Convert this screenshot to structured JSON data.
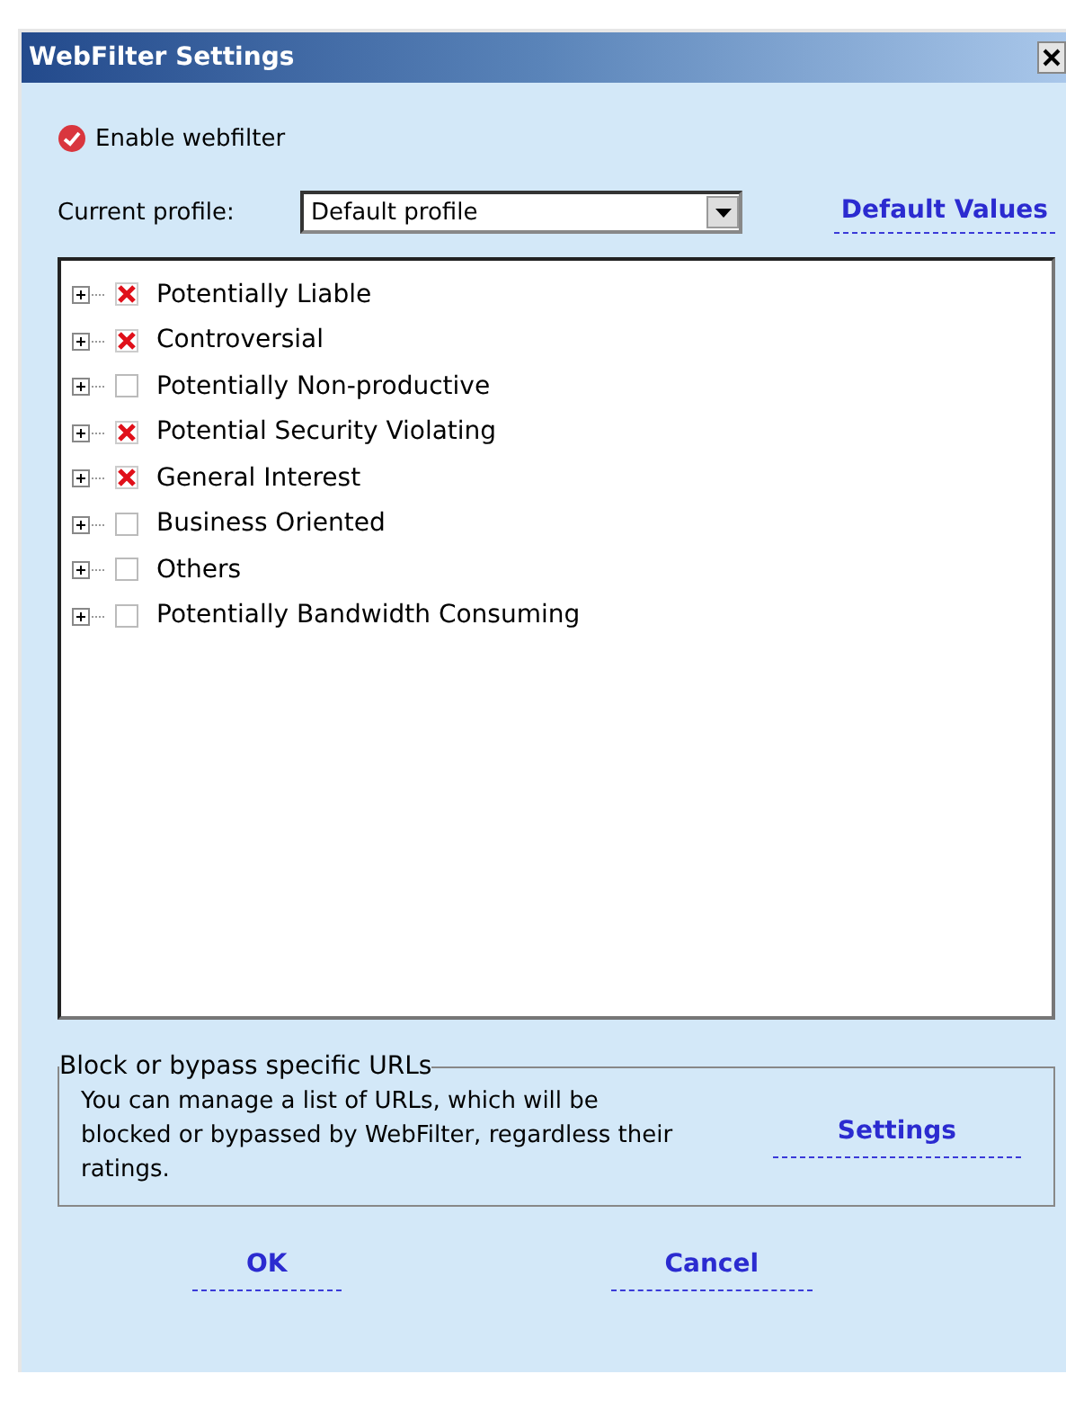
{
  "window": {
    "title": "WebFilter Settings"
  },
  "enable": {
    "label": "Enable webfilter",
    "checked": true
  },
  "profile": {
    "label": "Current profile:",
    "value": "Default profile",
    "default_link": "Default Values"
  },
  "categories": [
    {
      "label": "Potentially Liable",
      "checked": true
    },
    {
      "label": "Controversial",
      "checked": true
    },
    {
      "label": "Potentially Non-productive",
      "checked": false
    },
    {
      "label": "Potential Security Violating",
      "checked": true
    },
    {
      "label": "General Interest",
      "checked": true
    },
    {
      "label": "Business Oriented",
      "checked": false
    },
    {
      "label": "Others",
      "checked": false
    },
    {
      "label": "Potentially Bandwidth Consuming",
      "checked": false
    }
  ],
  "urls": {
    "title": "Block or bypass specific URLs",
    "text": "You can manage a list of URLs, which will be blocked or bypassed by WebFilter, regardless their ratings.",
    "link": "Settings"
  },
  "buttons": [
    "OK",
    "Cancel"
  ]
}
